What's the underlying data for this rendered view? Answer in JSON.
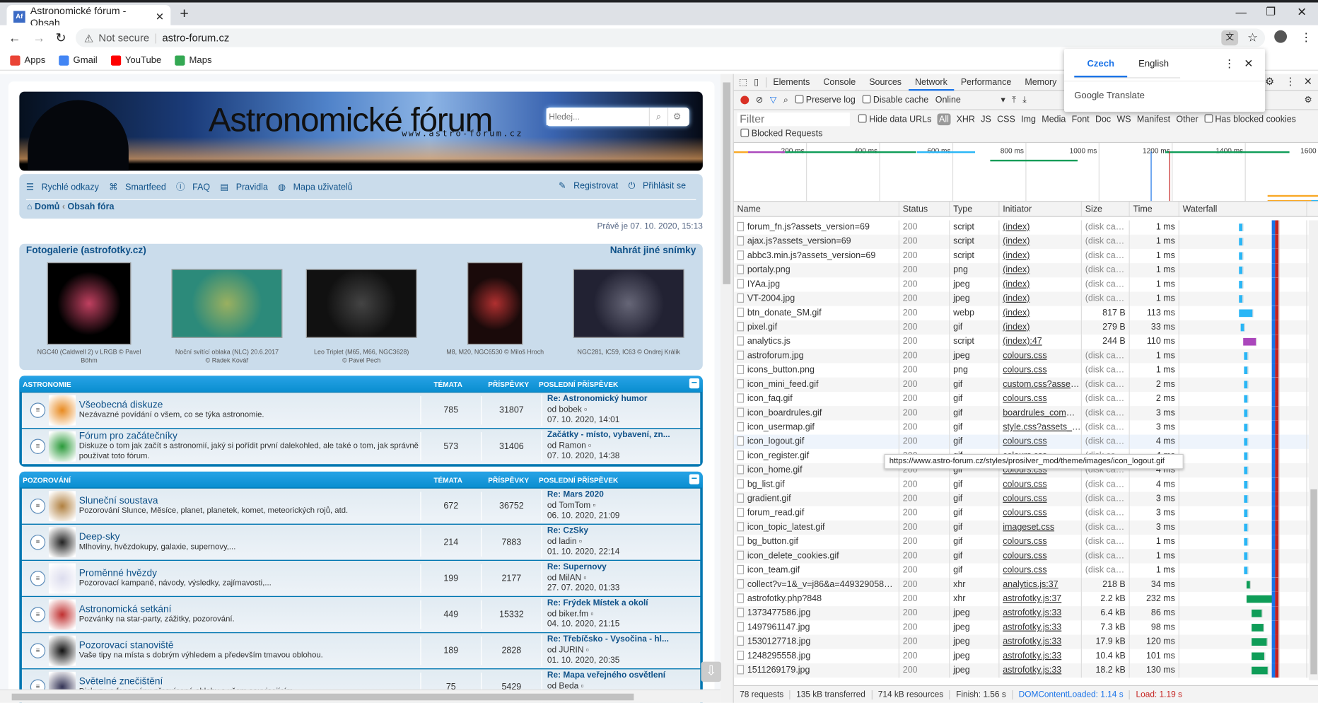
{
  "browser": {
    "tab_title": "Astronomické fórum - Obsah",
    "favicon": "Af",
    "new_tab": "+",
    "security": "Not secure",
    "url": "astro-forum.cz",
    "bookmarks": [
      {
        "label": "Apps",
        "color": "#ea4335"
      },
      {
        "label": "Gmail",
        "color": "#4285f4"
      },
      {
        "label": "YouTube",
        "color": "#ff0000"
      },
      {
        "label": "Maps",
        "color": "#34a853"
      }
    ]
  },
  "translate": {
    "tabs": [
      "Czech",
      "English"
    ],
    "active": "Czech",
    "brand": "Google Translate"
  },
  "forum": {
    "logo": "Astronomické fórum",
    "logo_url": "www.astro-forum.cz",
    "search_placeholder": "Hledej...",
    "nav_left": [
      "Rychlé odkazy",
      "Smartfeed",
      "FAQ",
      "Pravidla",
      "Mapa uživatelů"
    ],
    "nav_right": [
      "Registrovat",
      "Přihlásit se"
    ],
    "breadcrumb": [
      "Domů",
      "Obsah fóra"
    ],
    "now": "Právě je 07. 10. 2020, 15:13",
    "gallery": {
      "title": "Fotogalerie (astrofotky.cz)",
      "link": "Nahrát jiné snímky",
      "items": [
        {
          "caption": "NGC40 (Caldwell 2) v LRGB © Pavel Böhm",
          "colors": [
            "#000",
            "#c04060"
          ]
        },
        {
          "caption": "Noční svítící oblaka (NLC) 20.6.2017\n© Radek Kovář",
          "colors": [
            "#2c8a7a",
            "#9ab060"
          ]
        },
        {
          "caption": "Leo Triplet (M65, M66, NGC3628)\n© Pavel Pech",
          "colors": [
            "#111",
            "#444"
          ]
        },
        {
          "caption": "M8, M20, NGC6530 © Miloš Hroch",
          "colors": [
            "#1a0a0a",
            "#b03030"
          ]
        },
        {
          "caption": "NGC281, IC59, IC63 © Ondrej Králik",
          "colors": [
            "#223",
            "#667"
          ]
        }
      ]
    },
    "col_topics": "TÉMATA",
    "col_posts": "PŘÍSPĚVKY",
    "col_last": "POSLEDNÍ PŘÍSPĚVEK",
    "categories": [
      {
        "name": "ASTRONOMIE",
        "forums": [
          {
            "title": "Všeobecná diskuze",
            "desc": "Nezávazné povídání o všem, co se týka astronomie.",
            "topics": "785",
            "posts": "31807",
            "last": "Re: Astronomický humor",
            "by": "od bobek",
            "date": "07. 10. 2020, 14:01",
            "icon": "#e88a20"
          },
          {
            "title": "Fórum pro začátečníky",
            "desc": "Diskuze o tom jak začít s astronomií, jaký si pořídit první dalekohled, ale také o tom, jak správně používat toto fórum.",
            "topics": "573",
            "posts": "31406",
            "last": "Začátky - místo, vybavení, zn...",
            "by": "od Ramon",
            "date": "07. 10. 2020, 14:38",
            "icon": "#2a9a3a"
          }
        ]
      },
      {
        "name": "POZOROVÁNÍ",
        "forums": [
          {
            "title": "Sluneční soustava",
            "desc": "Pozorování Slunce, Měsíce, planet, planetek, komet, meteorických rojů, atd.",
            "topics": "672",
            "posts": "36752",
            "last": "Re: Mars 2020",
            "by": "od TomTom",
            "date": "06. 10. 2020, 21:09",
            "icon": "#b08040"
          },
          {
            "title": "Deep-sky",
            "desc": "Mlhoviny, hvězdokupy, galaxie, supernovy,...",
            "topics": "214",
            "posts": "7883",
            "last": "Re: CzSky",
            "by": "od ladin",
            "date": "01. 10. 2020, 22:14",
            "icon": "#222"
          },
          {
            "title": "Proměnné hvězdy",
            "desc": "Pozorovací kampaně, návody, výsledky, zajímavosti,...",
            "topics": "199",
            "posts": "2177",
            "last": "Re: Supernovy",
            "by": "od MilAN",
            "date": "27. 07. 2020, 01:33",
            "icon": "#dde"
          },
          {
            "title": "Astronomická setkání",
            "desc": "Pozvánky na star-party, zážitky, pozorování.",
            "topics": "449",
            "posts": "15332",
            "last": "Re: Frýdek Místek a okolí",
            "by": "od biker.fm",
            "date": "04. 10. 2020, 21:15",
            "icon": "#c03030"
          },
          {
            "title": "Pozorovací stanoviště",
            "desc": "Vaše tipy na místa s dobrým výhledem a především tmavou oblohou.",
            "topics": "189",
            "posts": "2828",
            "last": "Re: Třebíčsko - Vysočina - hl...",
            "by": "od JURIN",
            "date": "01. 10. 2020, 20:35",
            "icon": "#111"
          },
          {
            "title": "Světelné znečištění",
            "desc": "Diskuze o fenoménu přesvícené oblohy a všem souvisejícím.",
            "topics": "75",
            "posts": "5429",
            "last": "Re: Mapa veřejného osvětlení",
            "by": "od Beda",
            "date": "",
            "icon": "#335"
          }
        ]
      }
    ]
  },
  "devtools": {
    "tabs": [
      "Elements",
      "Console",
      "Sources",
      "Network",
      "Performance",
      "Memory"
    ],
    "active_tab": "Network",
    "toolbar": {
      "preserve_log": "Preserve log",
      "disable_cache": "Disable cache",
      "throttle": "Online"
    },
    "filter_placeholder": "Filter",
    "hide_data_urls": "Hide data URLs",
    "types": [
      "All",
      "XHR",
      "JS",
      "CSS",
      "Img",
      "Media",
      "Font",
      "Doc",
      "WS",
      "Manifest",
      "Other"
    ],
    "has_blocked_cookies": "Has blocked cookies",
    "blocked_requests": "Blocked Requests",
    "overview_ticks": [
      "200 ms",
      "400 ms",
      "600 ms",
      "800 ms",
      "1000 ms",
      "1200 ms",
      "1400 ms",
      "1600"
    ],
    "columns": [
      "Name",
      "Status",
      "Type",
      "Initiator",
      "Size",
      "Time",
      "Waterfall"
    ],
    "rows": [
      [
        "forum_fn.js?assets_version=69",
        "200",
        "script",
        "(index)",
        "(disk cache)",
        "1 ms"
      ],
      [
        "ajax.js?assets_version=69",
        "200",
        "script",
        "(index)",
        "(disk cache)",
        "1 ms"
      ],
      [
        "abbc3.min.js?assets_version=69",
        "200",
        "script",
        "(index)",
        "(disk cache)",
        "1 ms"
      ],
      [
        "portaly.png",
        "200",
        "png",
        "(index)",
        "(disk cache)",
        "1 ms"
      ],
      [
        "IYAa.jpg",
        "200",
        "jpeg",
        "(index)",
        "(disk cache)",
        "1 ms"
      ],
      [
        "VT-2004.jpg",
        "200",
        "jpeg",
        "(index)",
        "(disk cache)",
        "1 ms"
      ],
      [
        "btn_donate_SM.gif",
        "200",
        "webp",
        "(index)",
        "817 B",
        "113 ms"
      ],
      [
        "pixel.gif",
        "200",
        "gif",
        "(index)",
        "279 B",
        "33 ms"
      ],
      [
        "analytics.js",
        "200",
        "script",
        "(index):47",
        "244 B",
        "110 ms"
      ],
      [
        "astroforum.jpg",
        "200",
        "jpeg",
        "colours.css",
        "(disk cache)",
        "1 ms"
      ],
      [
        "icons_button.png",
        "200",
        "png",
        "colours.css",
        "(disk cache)",
        "1 ms"
      ],
      [
        "icon_mini_feed.gif",
        "200",
        "gif",
        "custom.css?assets_...",
        "(disk cache)",
        "2 ms"
      ],
      [
        "icon_faq.gif",
        "200",
        "gif",
        "colours.css",
        "(disk cache)",
        "2 ms"
      ],
      [
        "icon_boardrules.gif",
        "200",
        "gif",
        "boardrules_commo...",
        "(disk cache)",
        "3 ms"
      ],
      [
        "icon_usermap.gif",
        "200",
        "gif",
        "style.css?assets_ver...",
        "(disk cache)",
        "3 ms"
      ],
      [
        "icon_logout.gif",
        "200",
        "gif",
        "colours.css",
        "(disk cache)",
        "4 ms"
      ],
      [
        "icon_register.gif",
        "200",
        "gif",
        "colours.css",
        "(disk cache)",
        "4 ms"
      ],
      [
        "icon_home.gif",
        "200",
        "gif",
        "colours.css",
        "(disk cache)",
        "4 ms"
      ],
      [
        "bg_list.gif",
        "200",
        "gif",
        "colours.css",
        "(disk cache)",
        "4 ms"
      ],
      [
        "gradient.gif",
        "200",
        "gif",
        "colours.css",
        "(disk cache)",
        "3 ms"
      ],
      [
        "forum_read.gif",
        "200",
        "gif",
        "colours.css",
        "(disk cache)",
        "3 ms"
      ],
      [
        "icon_topic_latest.gif",
        "200",
        "gif",
        "imageset.css",
        "(disk cache)",
        "3 ms"
      ],
      [
        "bg_button.gif",
        "200",
        "gif",
        "colours.css",
        "(disk cache)",
        "1 ms"
      ],
      [
        "icon_delete_cookies.gif",
        "200",
        "gif",
        "colours.css",
        "(disk cache)",
        "1 ms"
      ],
      [
        "icon_team.gif",
        "200",
        "gif",
        "colours.css",
        "(disk cache)",
        "1 ms"
      ],
      [
        "collect?v=1&_v=j86&a=449329058&t...",
        "200",
        "xhr",
        "analytics.js:37",
        "218 B",
        "34 ms"
      ],
      [
        "astrofotky.php?848",
        "200",
        "xhr",
        "astrofotky.js:37",
        "2.2 kB",
        "232 ms"
      ],
      [
        "1373477586.jpg",
        "200",
        "jpeg",
        "astrofotky.js:33",
        "6.4 kB",
        "86 ms"
      ],
      [
        "1497961147.jpg",
        "200",
        "jpeg",
        "astrofotky.js:33",
        "7.3 kB",
        "98 ms"
      ],
      [
        "1530127718.jpg",
        "200",
        "jpeg",
        "astrofotky.js:33",
        "17.9 kB",
        "120 ms"
      ],
      [
        "1248295558.jpg",
        "200",
        "jpeg",
        "astrofotky.js:33",
        "10.4 kB",
        "101 ms"
      ],
      [
        "1511269179.jpg",
        "200",
        "jpeg",
        "astrofotky.js:33",
        "18.2 kB",
        "130 ms"
      ]
    ],
    "tooltip": "https://www.astro-forum.cz/styles/prosilver_mod/theme/images/icon_logout.gif",
    "status": {
      "requests": "78 requests",
      "transferred": "135 kB transferred",
      "resources": "714 kB resources",
      "finish": "Finish: 1.56 s",
      "dcl": "DOMContentLoaded: 1.14 s",
      "load": "Load: 1.19 s"
    },
    "colors": {
      "dcl": "#1a73e8",
      "load": "#c5221f",
      "accent": "#1a73e8"
    }
  }
}
